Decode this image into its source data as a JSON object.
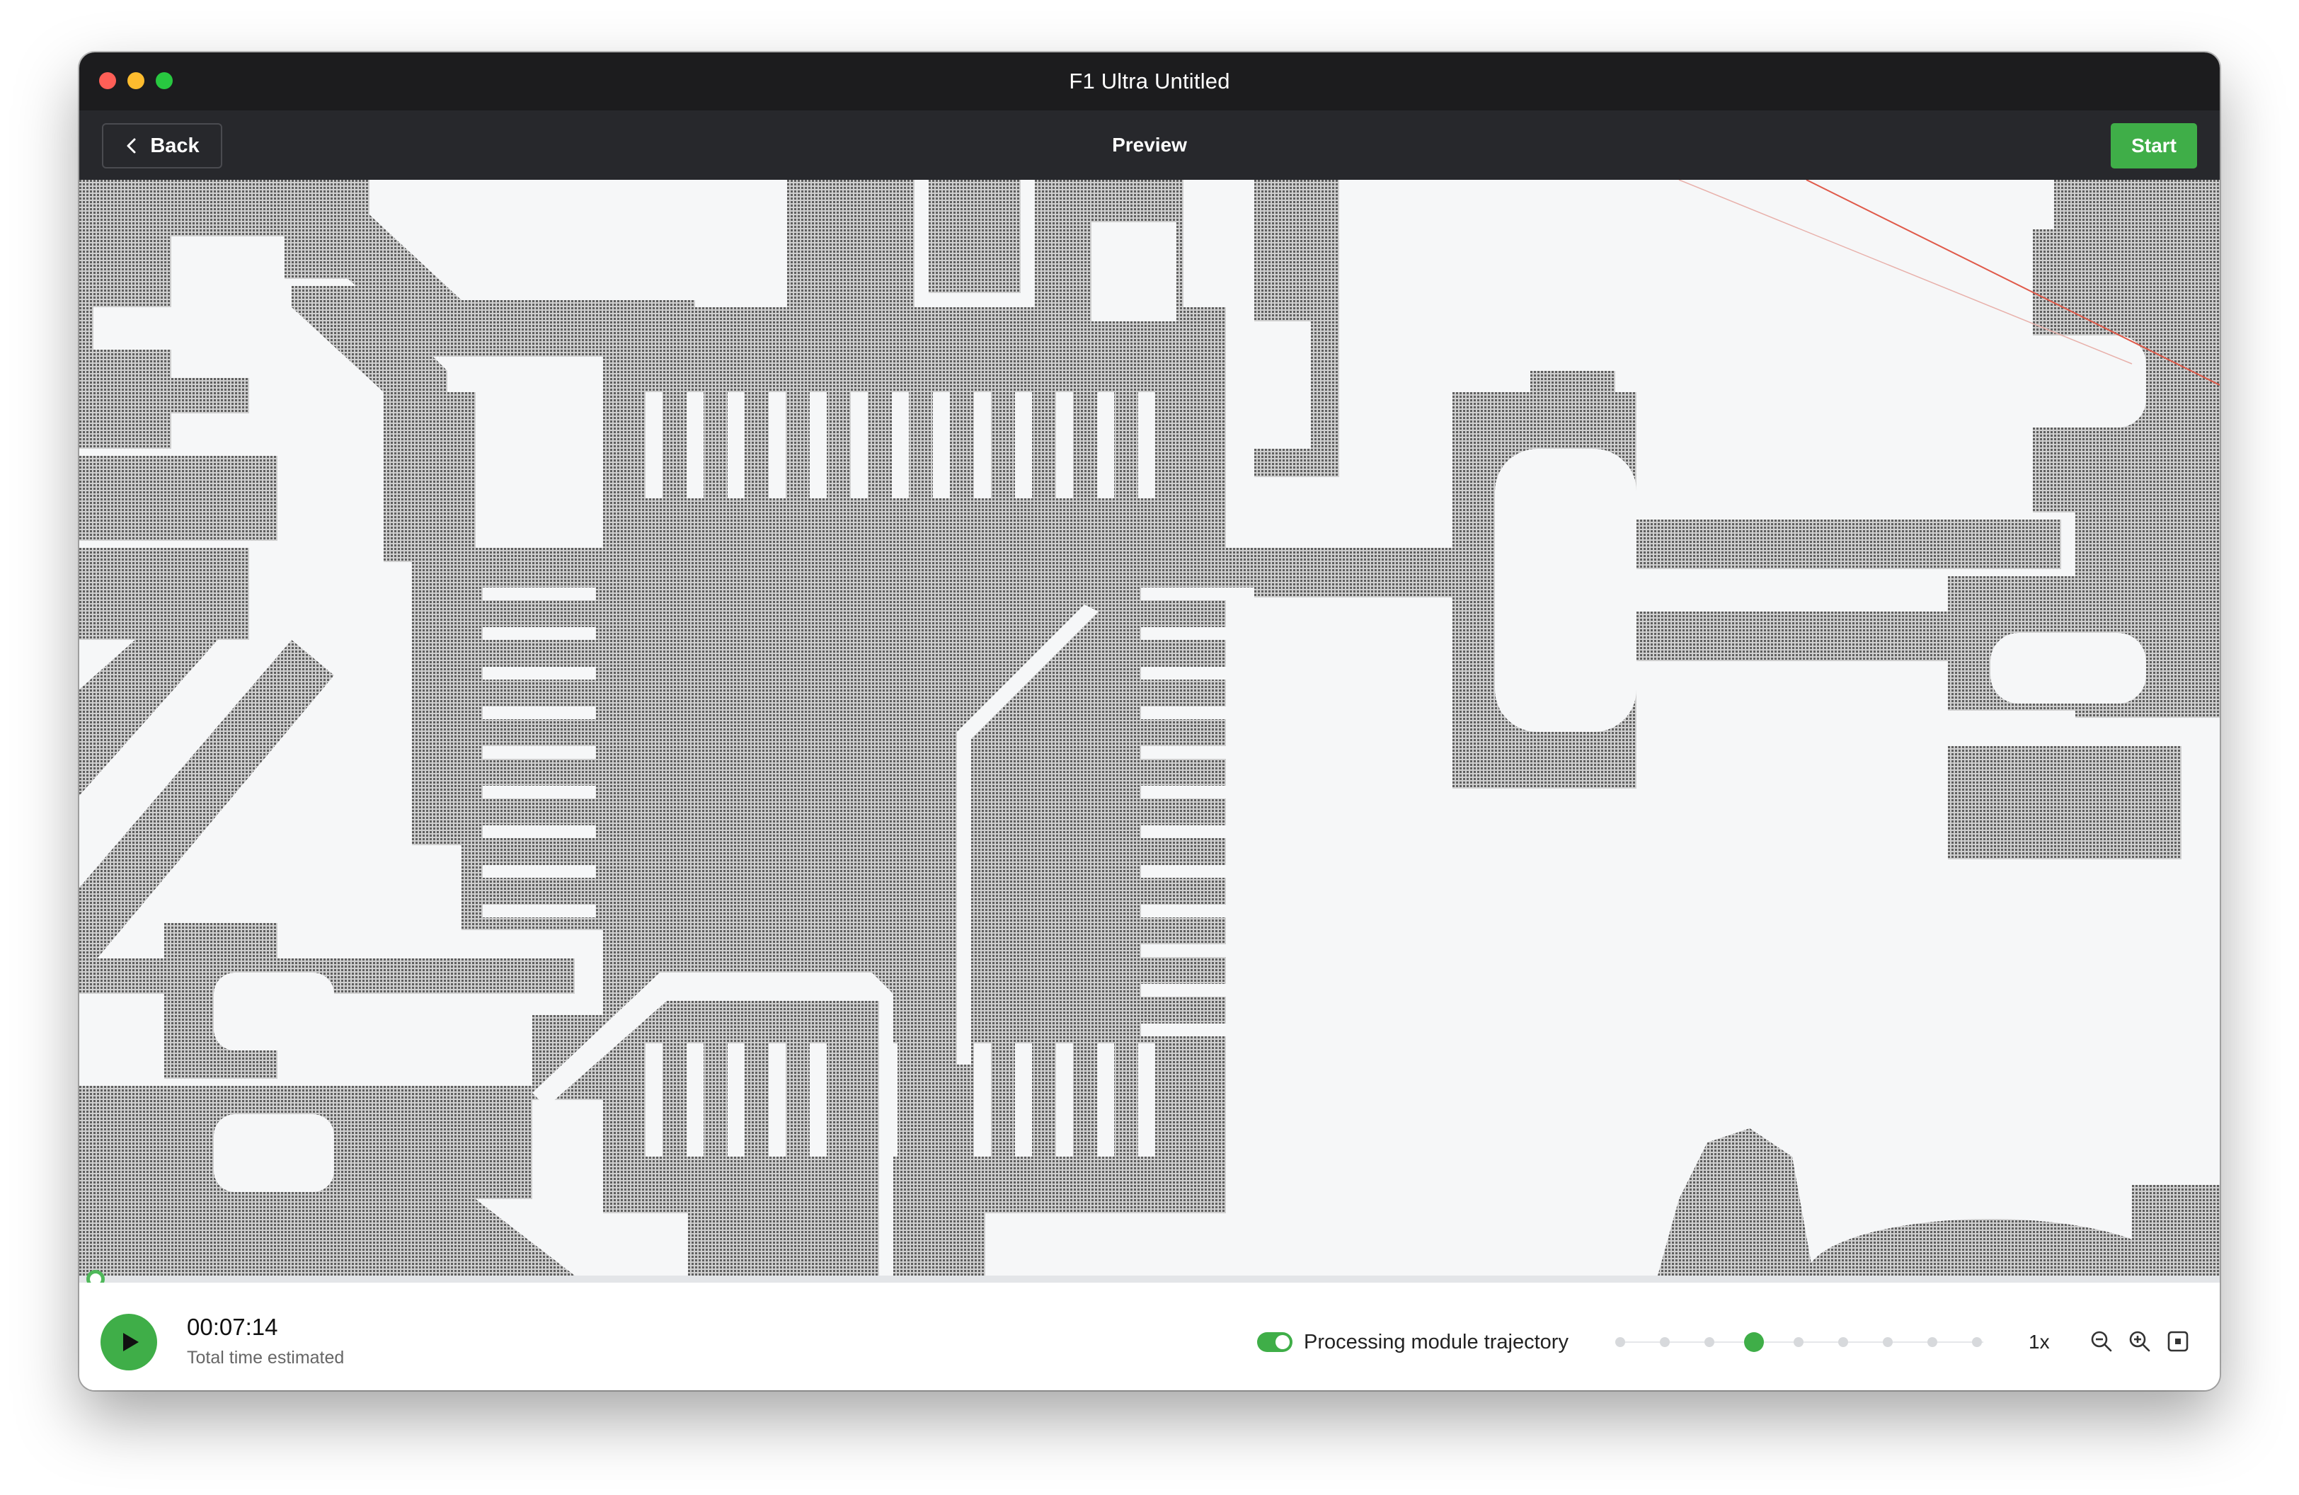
{
  "window": {
    "title": "F1 Ultra Untitled"
  },
  "toolbar": {
    "back_label": "Back",
    "title": "Preview",
    "start_label": "Start"
  },
  "playback": {
    "time": "00:07:14",
    "time_caption": "Total time estimated",
    "progress_fraction": 0.0
  },
  "trajectory": {
    "label": "Processing module trajectory",
    "enabled": true
  },
  "speed": {
    "label": "1x",
    "steps": 9,
    "selected_index": 3
  },
  "colors": {
    "accent": "#3fae48",
    "trace": "#7a7a7a",
    "background": "#f6f7f8"
  },
  "icons": [
    "back-chevron-icon",
    "play-icon",
    "zoom-out-icon",
    "zoom-in-icon",
    "fit-view-icon"
  ]
}
